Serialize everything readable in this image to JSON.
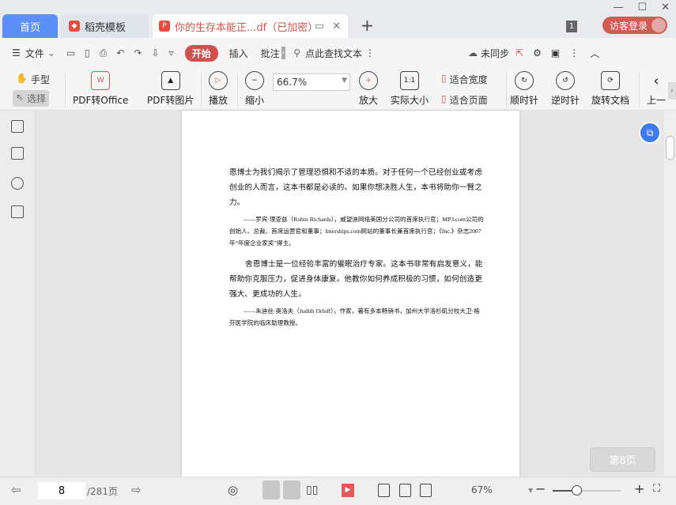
{
  "tabs": [
    {
      "label": "首页"
    },
    {
      "label": "稻壳模板"
    },
    {
      "label": "你的生存本能正...df（已加密）"
    }
  ],
  "window": {
    "minimize": "—",
    "maximize": "☐",
    "close": "✕",
    "new_tab": "+",
    "tab_count": "1",
    "login": "访客登录"
  },
  "menu": {
    "file": "文件",
    "start": "开始",
    "insert": "插入",
    "annotate": "批注",
    "search": "点此查找文本",
    "sync": "未同步"
  },
  "ribbon": {
    "hand": "手型",
    "select": "选择",
    "pdf_office": "PDF转Office",
    "pdf_image": "PDF转图片",
    "play": "播放",
    "zoom_out": "缩小",
    "zoom_value": "66.7%",
    "zoom_in": "放大",
    "actual": "实际大小",
    "fit_width": "适合宽度",
    "fit_page": "适合页面",
    "clockwise": "顺时针",
    "counter": "逆时针",
    "rotate": "旋转文档",
    "prev": "上一"
  },
  "document": {
    "p1": "恩博士为我们揭示了管理恐惧和不适的本质。对于任何一个已经创业或考虑创业的人而言，这本书都是必读的。如果你想决胜人生，本书将助你一臂之力。",
    "c1": "——罗宾·理查兹（Robin Richards），威望迪网络美国分公司的首席执行官；MP3.com公司的创始人、总裁、首席运营官和董事；Interships.com网站的董事长兼首席执行官；《Inc.》杂志2007年“年度企业家奖”得主。",
    "p2": "舍恩博士是一位经验丰富的催眠治疗专家。这本书非常有启发意义，能帮助你克服压力，促进身体康复。他教你如何养成积极的习惯，如何创造更强大、更成功的人生。",
    "c2": "——朱迪丝·奥洛夫（Judith Orloff），作家，著有多本畅销书，加州大学洛杉矶分校大卫·格芬医学院的临床助理教授。"
  },
  "page_badge": "第8页",
  "status": {
    "page": "8",
    "total": "/281页",
    "zoom": "67%",
    "zoom_slider_percent": 35
  }
}
